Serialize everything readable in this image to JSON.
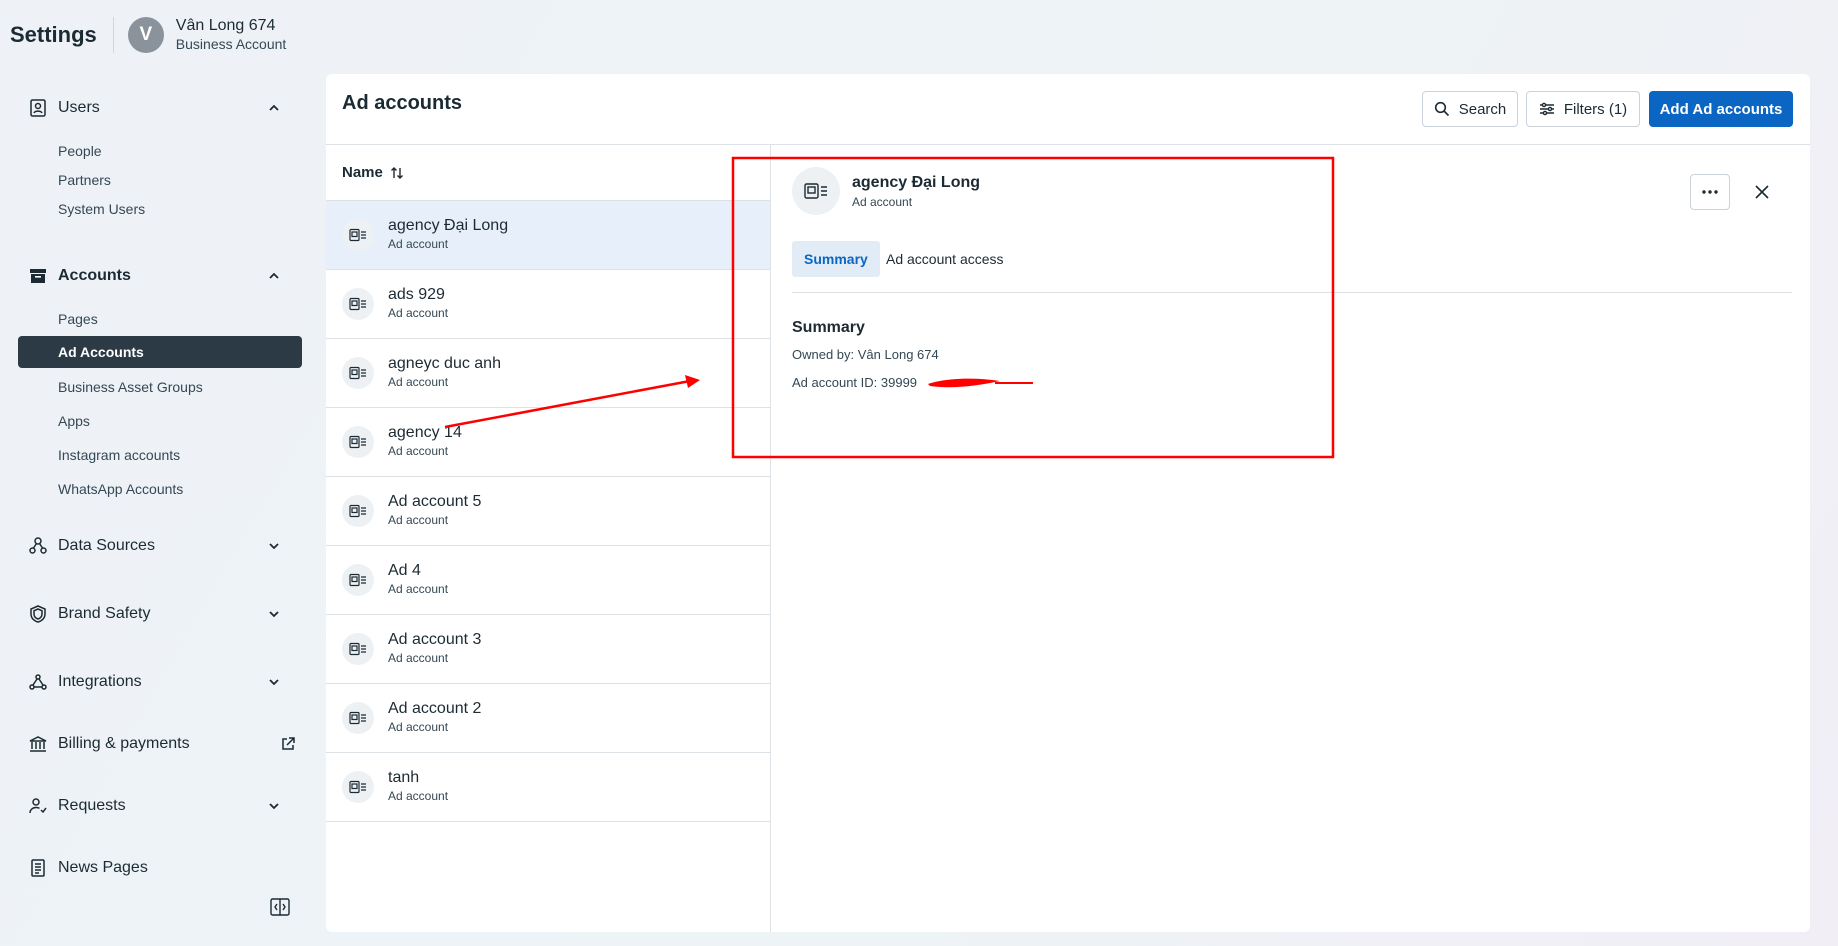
{
  "header": {
    "title": "Settings",
    "avatar_letter": "V",
    "account_name": "Vân Long 674",
    "account_type": "Business Account"
  },
  "sidebar": {
    "sections": [
      {
        "label": "Users",
        "icon": "users-icon",
        "expanded": true,
        "items": [
          "People",
          "Partners",
          "System Users"
        ]
      },
      {
        "label": "Accounts",
        "icon": "accounts-icon",
        "expanded": true,
        "items": [
          "Pages",
          "Ad Accounts",
          "Business Asset Groups",
          "Apps",
          "Instagram accounts",
          "WhatsApp Accounts"
        ],
        "active_item": "Ad Accounts"
      },
      {
        "label": "Data Sources",
        "icon": "data-sources-icon",
        "expanded": false
      },
      {
        "label": "Brand Safety",
        "icon": "shield-icon",
        "expanded": false
      },
      {
        "label": "Integrations",
        "icon": "integrations-icon",
        "expanded": false
      },
      {
        "label": "Billing & payments",
        "icon": "bank-icon",
        "external": true
      },
      {
        "label": "Requests",
        "icon": "requests-icon",
        "expanded": false
      },
      {
        "label": "News Pages",
        "icon": "news-icon"
      }
    ]
  },
  "main": {
    "title": "Ad accounts",
    "search_label": "Search",
    "filters_label": "Filters (1)",
    "add_label": "Add Ad accounts",
    "list_header": "Name",
    "accounts": [
      {
        "name": "agency Đại Long",
        "type": "Ad account"
      },
      {
        "name": "ads 929",
        "type": "Ad account"
      },
      {
        "name": "agneyc duc anh",
        "type": "Ad account"
      },
      {
        "name": "agency 14",
        "type": "Ad account"
      },
      {
        "name": "Ad account 5",
        "type": "Ad account"
      },
      {
        "name": "Ad 4",
        "type": "Ad account"
      },
      {
        "name": "Ad account 3",
        "type": "Ad account"
      },
      {
        "name": "Ad account 2",
        "type": "Ad account"
      },
      {
        "name": "tanh",
        "type": "Ad account"
      }
    ]
  },
  "detail": {
    "name": "agency Đại Long",
    "type": "Ad account",
    "tabs": [
      "Summary",
      "Ad account access"
    ],
    "active_tab": "Summary",
    "summary_title": "Summary",
    "owned_by": "Owned by: Vân Long 674",
    "ad_account_id": "Ad account ID: 39999"
  },
  "colors": {
    "primary": "#0a66c2",
    "active_nav": "#2b3a45",
    "selected_row": "#e7f0fa",
    "annotation": "#ff0000"
  }
}
